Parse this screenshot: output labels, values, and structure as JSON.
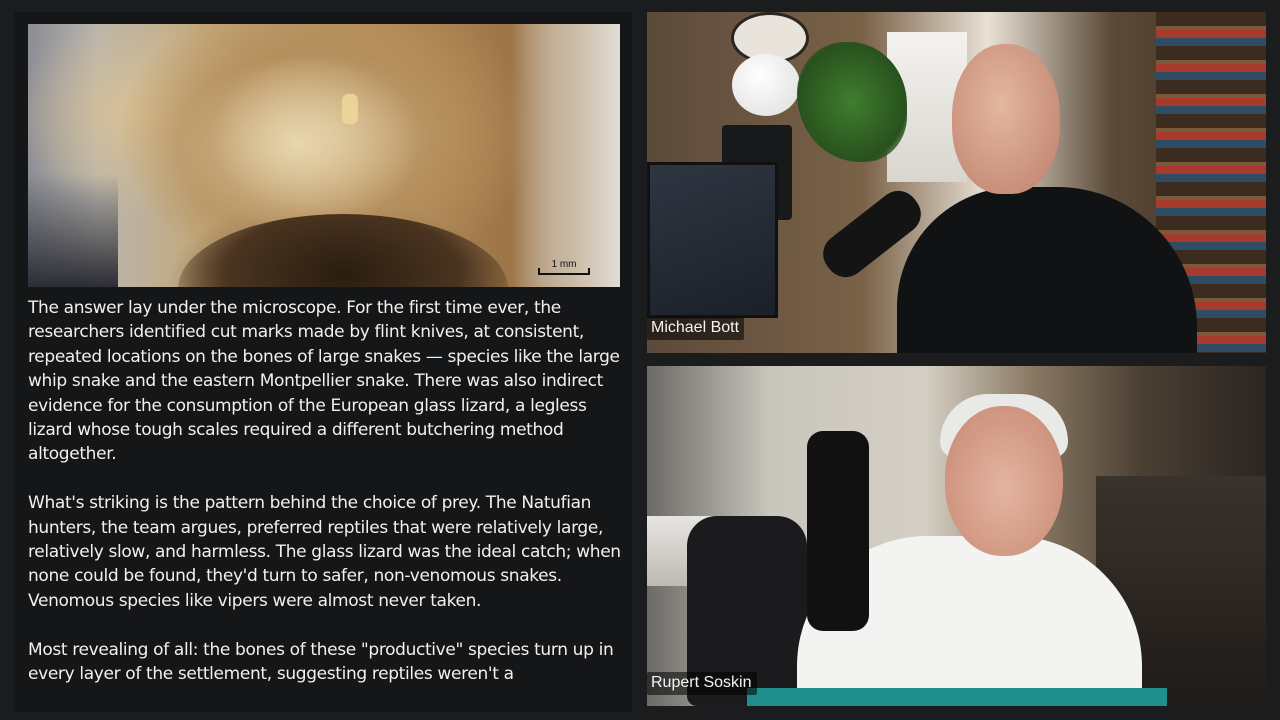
{
  "article": {
    "image": {
      "scale_label": "1 mm"
    },
    "paragraphs": [
      "The answer lay under the microscope. For the first time ever, the researchers identified cut marks made by flint knives, at consistent, repeated locations on the bones of large snakes — species like the large whip snake and the eastern Montpellier snake. There was also indirect evidence for the consumption of the European glass lizard, a legless lizard whose tough scales required a different butchering method altogether.",
      "What's striking is the pattern behind the choice of prey. The Natufian hunters, the team argues, preferred reptiles that were relatively large, relatively slow, and harmless. The glass lizard was the ideal catch; when none could be found, they'd turn to safer, non-venomous snakes. Venomous species like vipers were almost never taken.",
      "Most revealing of all: the bones of these \"productive\" species turn up in every layer of the settlement, suggesting reptiles weren't a"
    ]
  },
  "participants": [
    {
      "name": "Michael Bott"
    },
    {
      "name": "Rupert Soskin"
    }
  ]
}
